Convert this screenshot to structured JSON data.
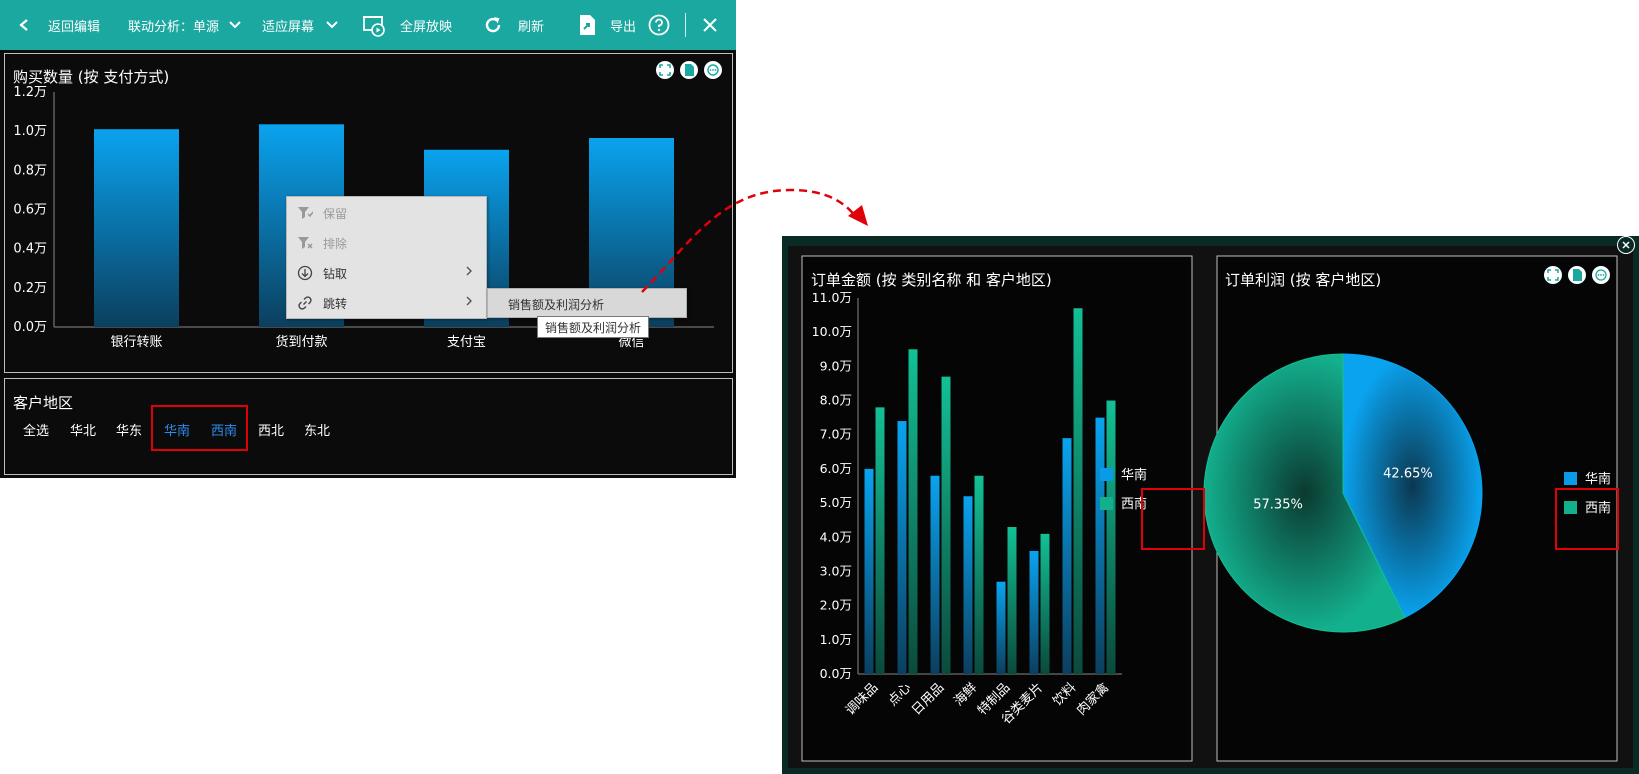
{
  "toolbar": {
    "back_label": "返回编辑",
    "linkage_label": "联动分析：单源",
    "fit_label": "适应屏幕",
    "fullscreen_label": "全屏放映",
    "refresh_label": "刷新",
    "export_label": "导出"
  },
  "bar_panel": {
    "title": "购买数量 (按 支付方式)"
  },
  "filter_panel": {
    "title": "客户地区",
    "items": [
      {
        "label": "全选",
        "selected": false
      },
      {
        "label": "华北",
        "selected": false
      },
      {
        "label": "华东",
        "selected": false
      },
      {
        "label": "华南",
        "selected": true
      },
      {
        "label": "西南",
        "selected": true
      },
      {
        "label": "西北",
        "selected": false
      },
      {
        "label": "东北",
        "selected": false
      }
    ]
  },
  "context_menu": {
    "items": [
      {
        "label": "保留",
        "icon": "filter-keep-icon",
        "disabled": true
      },
      {
        "label": "排除",
        "icon": "filter-exclude-icon",
        "disabled": true
      },
      {
        "label": "钻取",
        "icon": "drill-icon",
        "disabled": false
      },
      {
        "label": "跳转",
        "icon": "link-icon",
        "disabled": false
      }
    ],
    "submenu_item": "销售额及利润分析",
    "tooltip": "销售额及利润分析"
  },
  "order_panel": {
    "title": "订单金额 (按 类别名称 和 客户地区)"
  },
  "profit_panel": {
    "title": "订单利润 (按 客户地区)"
  },
  "colors": {
    "toolbar": "#1aa8a0",
    "series_south": "#0a9be8",
    "series_southwest": "#13b08e",
    "selected_text": "#2d8cf0",
    "highlight_box": "#e0000a"
  },
  "chart_data": [
    {
      "type": "bar",
      "title": "购买数量 (按 支付方式)",
      "categories": [
        "银行转账",
        "货到付款",
        "支付宝",
        "微信"
      ],
      "values": [
        10100,
        10350,
        9050,
        9650
      ],
      "ylim": [
        0,
        12000
      ],
      "yticks": [
        "0.0万",
        "0.2万",
        "0.4万",
        "0.6万",
        "0.8万",
        "1.0万",
        "1.2万"
      ],
      "grid": false
    },
    {
      "type": "bar",
      "title": "订单金额 (按 类别名称 和 客户地区)",
      "categories": [
        "调味品",
        "点心",
        "日用品",
        "海鲜",
        "特制品",
        "谷类麦片",
        "饮料",
        "肉家禽"
      ],
      "series": [
        {
          "name": "华南",
          "values": [
            60000,
            74000,
            58000,
            52000,
            27000,
            36000,
            69000,
            75000
          ]
        },
        {
          "name": "西南",
          "values": [
            78000,
            95000,
            87000,
            58000,
            43000,
            41000,
            107000,
            80000
          ]
        }
      ],
      "ylim": [
        0,
        110000
      ],
      "yticks": [
        "0.0万",
        "1.0万",
        "2.0万",
        "3.0万",
        "4.0万",
        "5.0万",
        "6.0万",
        "7.0万",
        "8.0万",
        "9.0万",
        "10.0万",
        "11.0万"
      ],
      "legend": "right",
      "grid": false
    },
    {
      "type": "pie",
      "title": "订单利润 (按 客户地区)",
      "series": [
        {
          "name": "华南",
          "value": 42.65,
          "label": "42.65%"
        },
        {
          "name": "西南",
          "value": 57.35,
          "label": "57.35%"
        }
      ],
      "legend": "right"
    }
  ]
}
